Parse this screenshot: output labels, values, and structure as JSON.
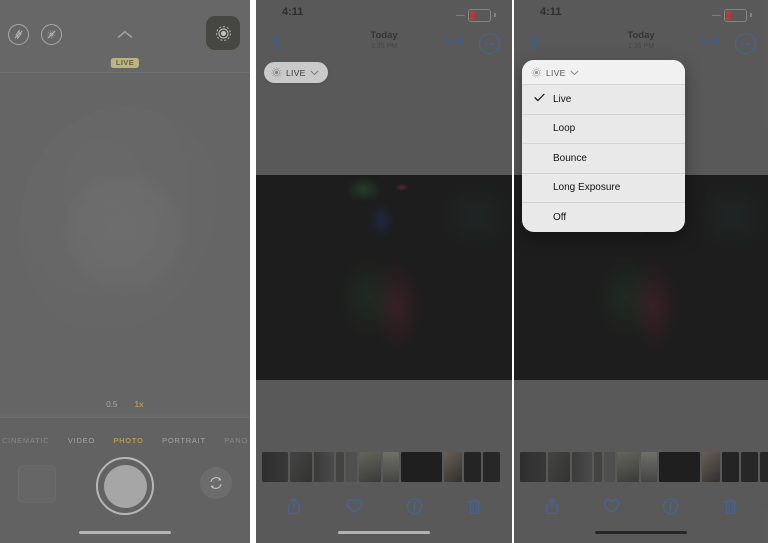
{
  "panels": {
    "camera": {
      "name": "Camera app viewfinder",
      "top_icons": [
        {
          "name": "flash-off-icon",
          "label": "Flash Off"
        },
        {
          "name": "live-photo-off-icon",
          "label": "Live Photo Off"
        }
      ],
      "chevron_up": "chevron-up-icon",
      "live_badge": "LIVE",
      "live_tile_icon": "live-photo-icon",
      "zoom_options": [
        {
          "label": "0.5",
          "selected": false
        },
        {
          "label": "1x",
          "selected": true
        }
      ],
      "modes": [
        {
          "label": "CINEMATIC",
          "selected": false
        },
        {
          "label": "VIDEO",
          "selected": false
        },
        {
          "label": "PHOTO",
          "selected": true
        },
        {
          "label": "PORTRAIT",
          "selected": false
        },
        {
          "label": "PANO",
          "selected": false
        }
      ],
      "shutter_label": "Shutter",
      "thumbnail_label": "Last photo thumbnail",
      "flip_label": "Flip camera"
    },
    "photo": {
      "name": "Photos app — single photo",
      "status_bar": {
        "time": "4:11",
        "battery_state": "low"
      },
      "nav": {
        "back": "Back",
        "title": "Today",
        "subtitle": "1:35 PM",
        "edit": "Edit",
        "more": "More options"
      },
      "live_pill": {
        "icon": "live-photo-icon",
        "label": "LIVE",
        "chevron": "chevron-down-icon"
      },
      "toolbar": [
        {
          "name": "share-icon",
          "label": "Share"
        },
        {
          "name": "heart-icon",
          "label": "Favorite"
        },
        {
          "name": "info-icon",
          "label": "Info"
        },
        {
          "name": "trash-icon",
          "label": "Delete"
        }
      ]
    },
    "menu": {
      "name": "Photos app — Live Photo effects menu open",
      "status_bar": {
        "time": "4:11",
        "battery_state": "low"
      },
      "nav": {
        "back": "Back",
        "title": "Today",
        "subtitle": "1:35 PM",
        "edit": "Edit",
        "more": "More options"
      },
      "menu_header": {
        "icon": "live-photo-icon",
        "label": "LIVE",
        "chevron": "chevron-down-icon"
      },
      "menu_items": [
        {
          "label": "Live",
          "checked": true
        },
        {
          "label": "Loop",
          "checked": false
        },
        {
          "label": "Bounce",
          "checked": false
        },
        {
          "label": "Long Exposure",
          "checked": false
        },
        {
          "label": "Off",
          "checked": false
        }
      ],
      "toolbar": [
        {
          "name": "share-icon",
          "label": "Share"
        },
        {
          "name": "heart-icon",
          "label": "Favorite"
        },
        {
          "name": "info-icon",
          "label": "Info"
        },
        {
          "name": "trash-icon",
          "label": "Delete"
        }
      ]
    }
  },
  "colors": {
    "accent_blue": "#3a6ab0",
    "camera_yellow": "#d8b447",
    "live_badge_bg": "#e4dd8e",
    "battery_red": "#d7322e",
    "menu_bg": "#e9e9e9"
  }
}
